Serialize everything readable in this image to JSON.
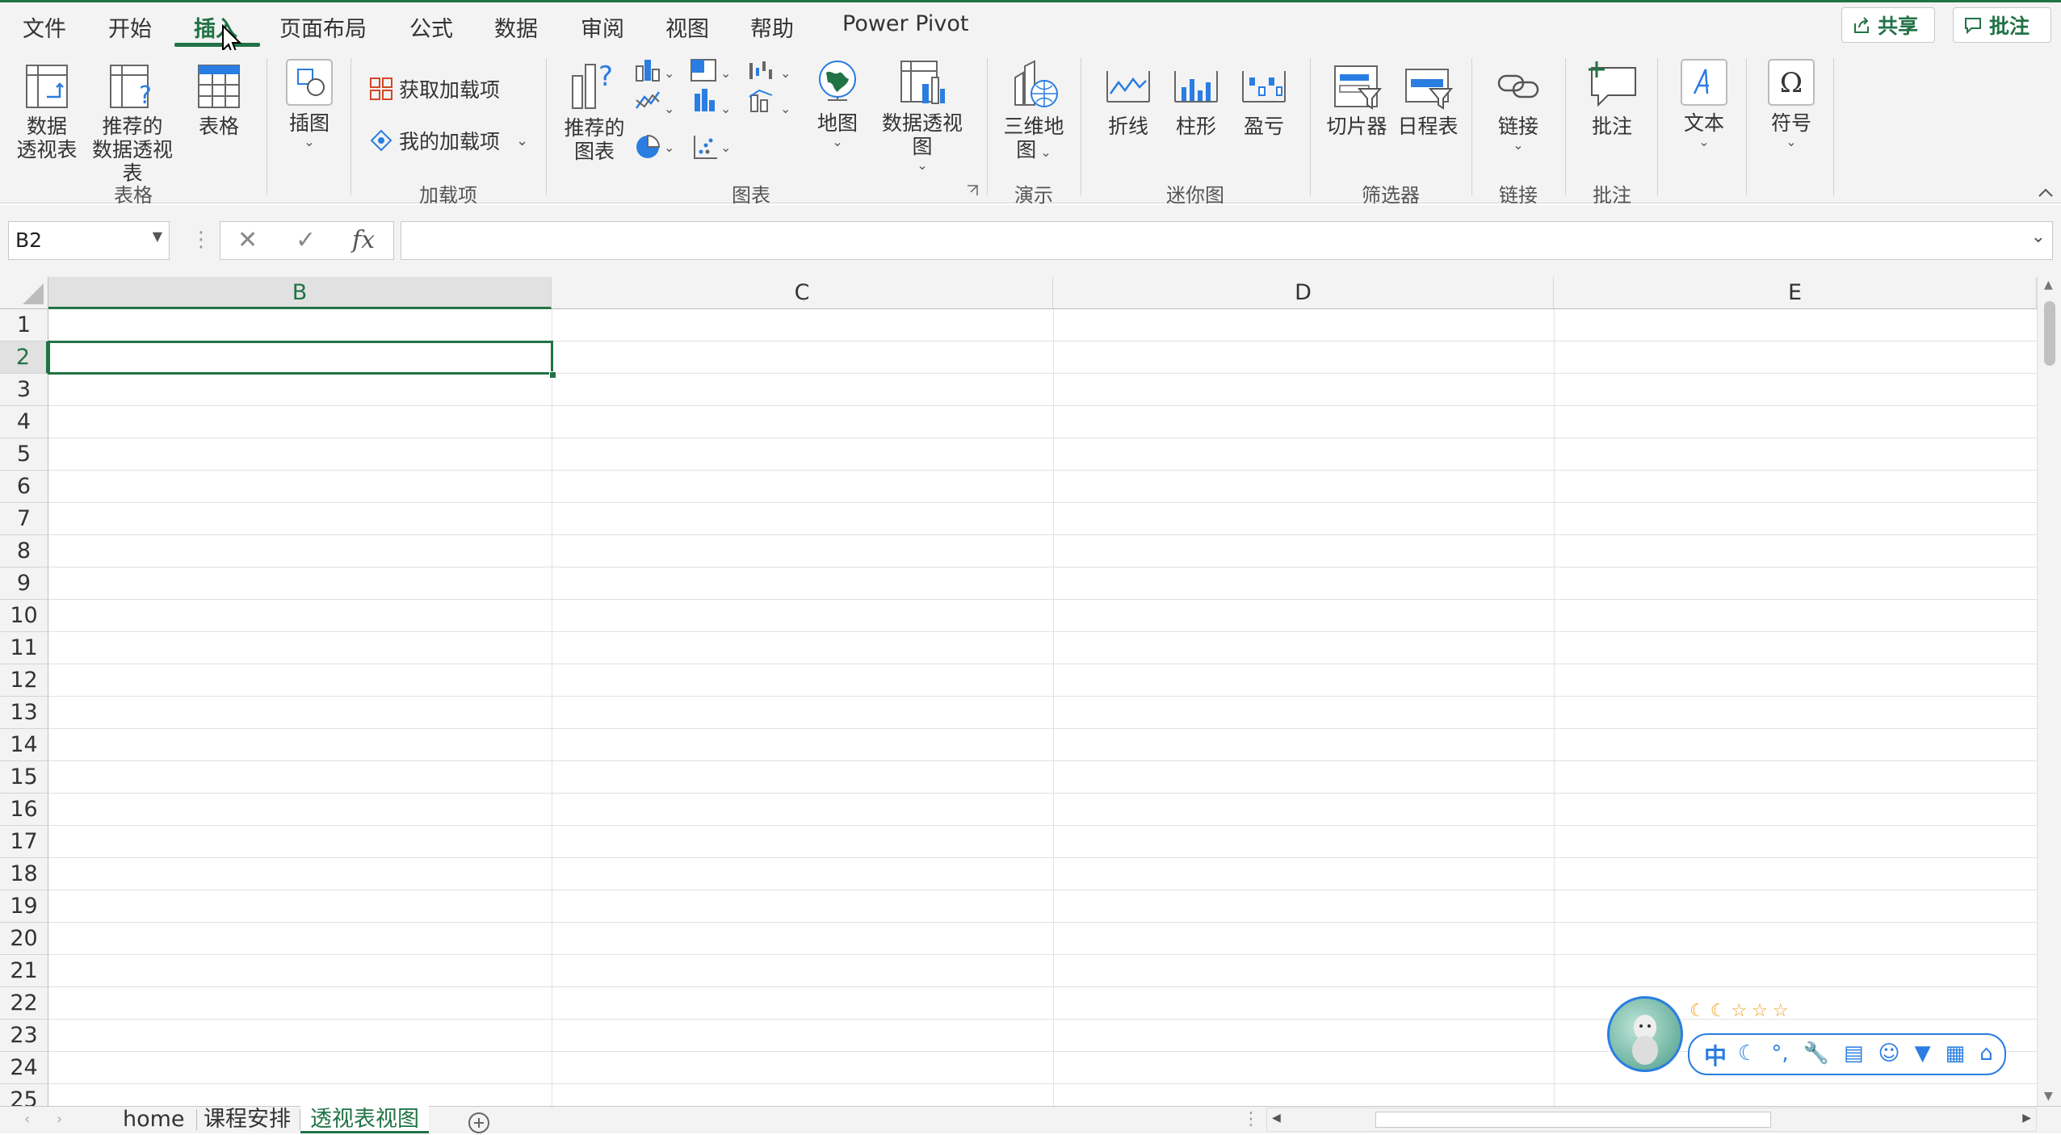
{
  "tabs": [
    "文件",
    "开始",
    "插入",
    "页面布局",
    "公式",
    "数据",
    "审阅",
    "视图",
    "帮助",
    "Power Pivot"
  ],
  "top_buttons": {
    "share": "共享",
    "comments": "批注"
  },
  "ribbon": {
    "table_group": {
      "label": "表格",
      "pivot": [
        "数据",
        "透视表"
      ],
      "rec_pivot": [
        "推荐的",
        "数据透视表"
      ],
      "table": "表格"
    },
    "illustrations": {
      "label": "插图"
    },
    "addins": {
      "label": "加载项",
      "get": "获取加载项",
      "mine": "我的加载项"
    },
    "charts": {
      "label": "图表",
      "recommended": [
        "推荐的",
        "图表"
      ],
      "map": "地图",
      "pivot_chart": "数据透视图"
    },
    "tours": {
      "label": "演示",
      "map3d": [
        "三维地",
        "图"
      ]
    },
    "sparklines": {
      "label": "迷你图",
      "line": "折线",
      "column": "柱形",
      "winloss": "盈亏"
    },
    "filters": {
      "label": "筛选器",
      "slicer": "切片器",
      "timeline": "日程表"
    },
    "links": {
      "label": "链接",
      "link": "链接"
    },
    "comments": {
      "label": "批注",
      "comment": "批注"
    },
    "text": {
      "label": "文本"
    },
    "symbols": {
      "label": "符号"
    }
  },
  "namebox": "B2",
  "formula": "",
  "columns": [
    "B",
    "C",
    "D",
    "E"
  ],
  "rows": [
    "1",
    "2",
    "3",
    "4",
    "5",
    "6",
    "7",
    "8",
    "9",
    "10",
    "11",
    "12",
    "13",
    "14",
    "15",
    "16",
    "17",
    "18",
    "19",
    "20",
    "21",
    "22",
    "23",
    "24",
    "25"
  ],
  "selected_cell": "B2",
  "sheets": [
    "home",
    "课程安排",
    "透视表视图"
  ],
  "active_sheet": "透视表视图",
  "ime": {
    "lang": "中"
  },
  "colors": {
    "accent": "#217346",
    "ribbon_bg": "#f3f3f3",
    "ime_blue": "#2a7de1"
  }
}
